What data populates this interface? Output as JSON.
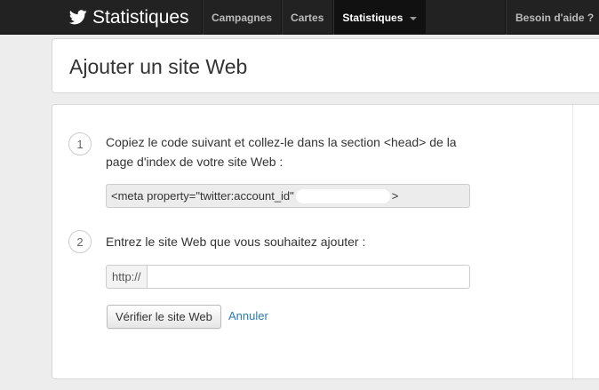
{
  "topbar": {
    "brand": "Statistiques",
    "nav": [
      {
        "label": "Campagnes"
      },
      {
        "label": "Cartes"
      },
      {
        "label": "Statistiques"
      }
    ],
    "help": "Besoin d'aide ?"
  },
  "page": {
    "title": "Ajouter un site Web"
  },
  "steps": {
    "step1": {
      "number": "1",
      "text_line1": "Copiez le code suivant et collez-le dans la section <head> de la",
      "text_line2": "page d'index de votre site Web :",
      "code_start": "<meta property=\"twitter:account_id\"",
      "code_end": ">"
    },
    "step2": {
      "number": "2",
      "text": "Entrez le site Web que vous souhaitez ajouter :",
      "url_prefix": "http://",
      "url_value": ""
    }
  },
  "actions": {
    "verify_label": "Vérifier le site Web",
    "cancel_label": "Annuler"
  },
  "colors": {
    "topbar": "#222222",
    "link": "#2a7ab0",
    "background": "#ededed"
  }
}
